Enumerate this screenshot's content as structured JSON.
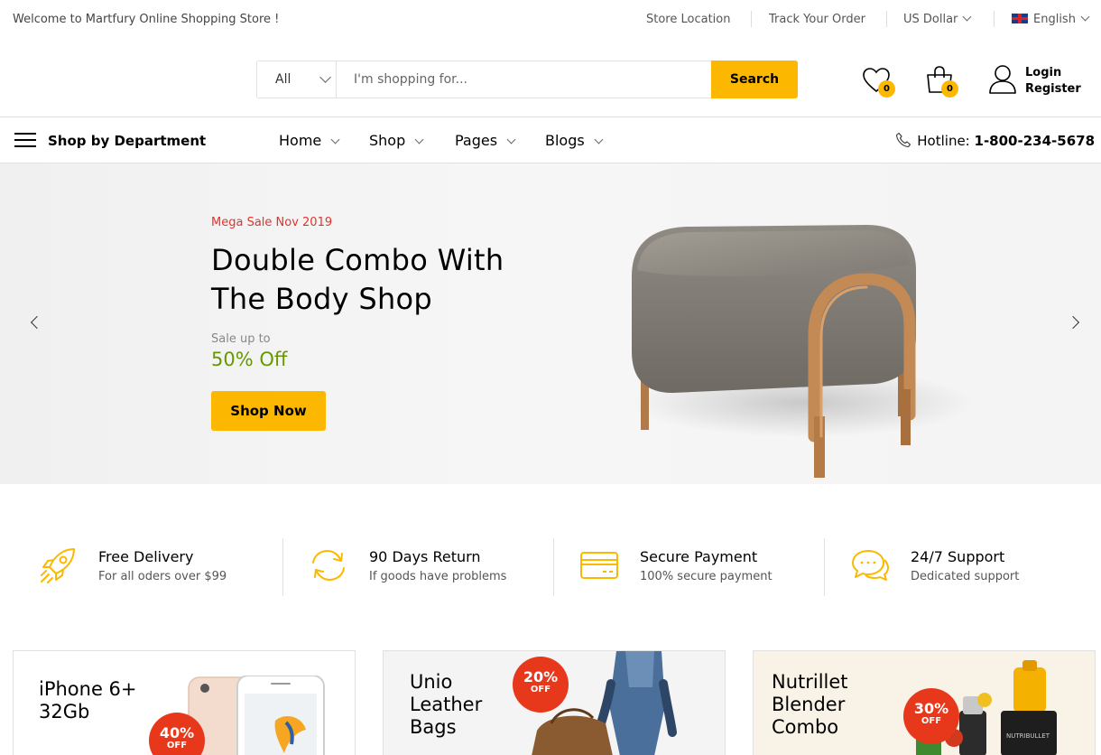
{
  "topbar": {
    "welcome": "Welcome to Martfury Online Shopping Store !",
    "store_location": "Store Location",
    "track_order": "Track Your Order",
    "currency": "US Dollar",
    "language": "English"
  },
  "header": {
    "search_category": "All",
    "search_placeholder": "I'm shopping for...",
    "search_button": "Search",
    "wishlist_count": "0",
    "cart_count": "0",
    "login": "Login",
    "register": "Register"
  },
  "nav": {
    "department": "Shop by Department",
    "items": [
      {
        "label": "Home"
      },
      {
        "label": "Shop"
      },
      {
        "label": "Pages"
      },
      {
        "label": "Blogs"
      }
    ],
    "hotline_label": "Hotline:",
    "hotline_number": "1-800-234-5678"
  },
  "hero": {
    "subtitle": "Mega Sale Nov 2019",
    "title_line1": "Double Combo With",
    "title_line2": "The Body Shop",
    "sale_up_to": "Sale up to",
    "discount": "50% Off",
    "button": "Shop Now"
  },
  "features": [
    {
      "title": "Free Delivery",
      "desc": "For all oders over $99",
      "icon": "rocket-icon"
    },
    {
      "title": "90 Days Return",
      "desc": "If goods have problems",
      "icon": "refresh-icon"
    },
    {
      "title": "Secure Payment",
      "desc": "100% secure payment",
      "icon": "credit-card-icon"
    },
    {
      "title": "24/7 Support",
      "desc": "Dedicated support",
      "icon": "chat-icon"
    }
  ],
  "promos": [
    {
      "line1": "iPhone 6+",
      "line2": "32Gb",
      "line3": "",
      "badge_percent": "40%",
      "badge_off": "OFF"
    },
    {
      "line1": "Unio",
      "line2": "Leather",
      "line3": "Bags",
      "badge_percent": "20%",
      "badge_off": "OFF"
    },
    {
      "line1": "Nutrillet",
      "line2": "Blender",
      "line3": "Combo",
      "badge_percent": "30%",
      "badge_off": "OFF",
      "product_brand": "NUTRIBULLET"
    }
  ],
  "colors": {
    "accent": "#fcb800",
    "sale_red": "#e5312c",
    "discount_green": "#669900",
    "badge_red": "#e8381c"
  }
}
